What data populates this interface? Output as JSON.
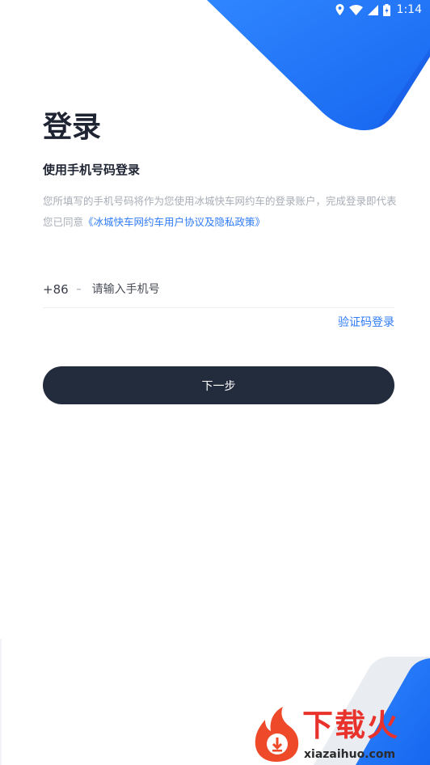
{
  "status_bar": {
    "time": "1:14",
    "icons": [
      "location-icon",
      "wifi-icon",
      "signal-icon",
      "battery-icon"
    ]
  },
  "login": {
    "title": "登录",
    "subtitle": "使用手机号码登录",
    "notice_text": "您所填写的手机号码将作为您使用冰城快车网约车的登录账户，完成登录即代表您已同意",
    "policy_link": "《冰城快车网约车用户协议及隐私政策》",
    "country_code": "+86",
    "phone_placeholder": "请输入手机号",
    "phone_value": "",
    "sms_login_label": "验证码登录",
    "next_button_label": "下一步"
  },
  "watermark": {
    "logo_text": "下载火",
    "domain": "xiazaihuo.com"
  },
  "colors": {
    "accent_blue": "#1d6ef5",
    "link_blue": "#2f7cf6",
    "button_dark": "#232c3c",
    "title_text": "#1f2433",
    "muted_text": "#a8adb6",
    "watermark_red": "#e8322b"
  }
}
